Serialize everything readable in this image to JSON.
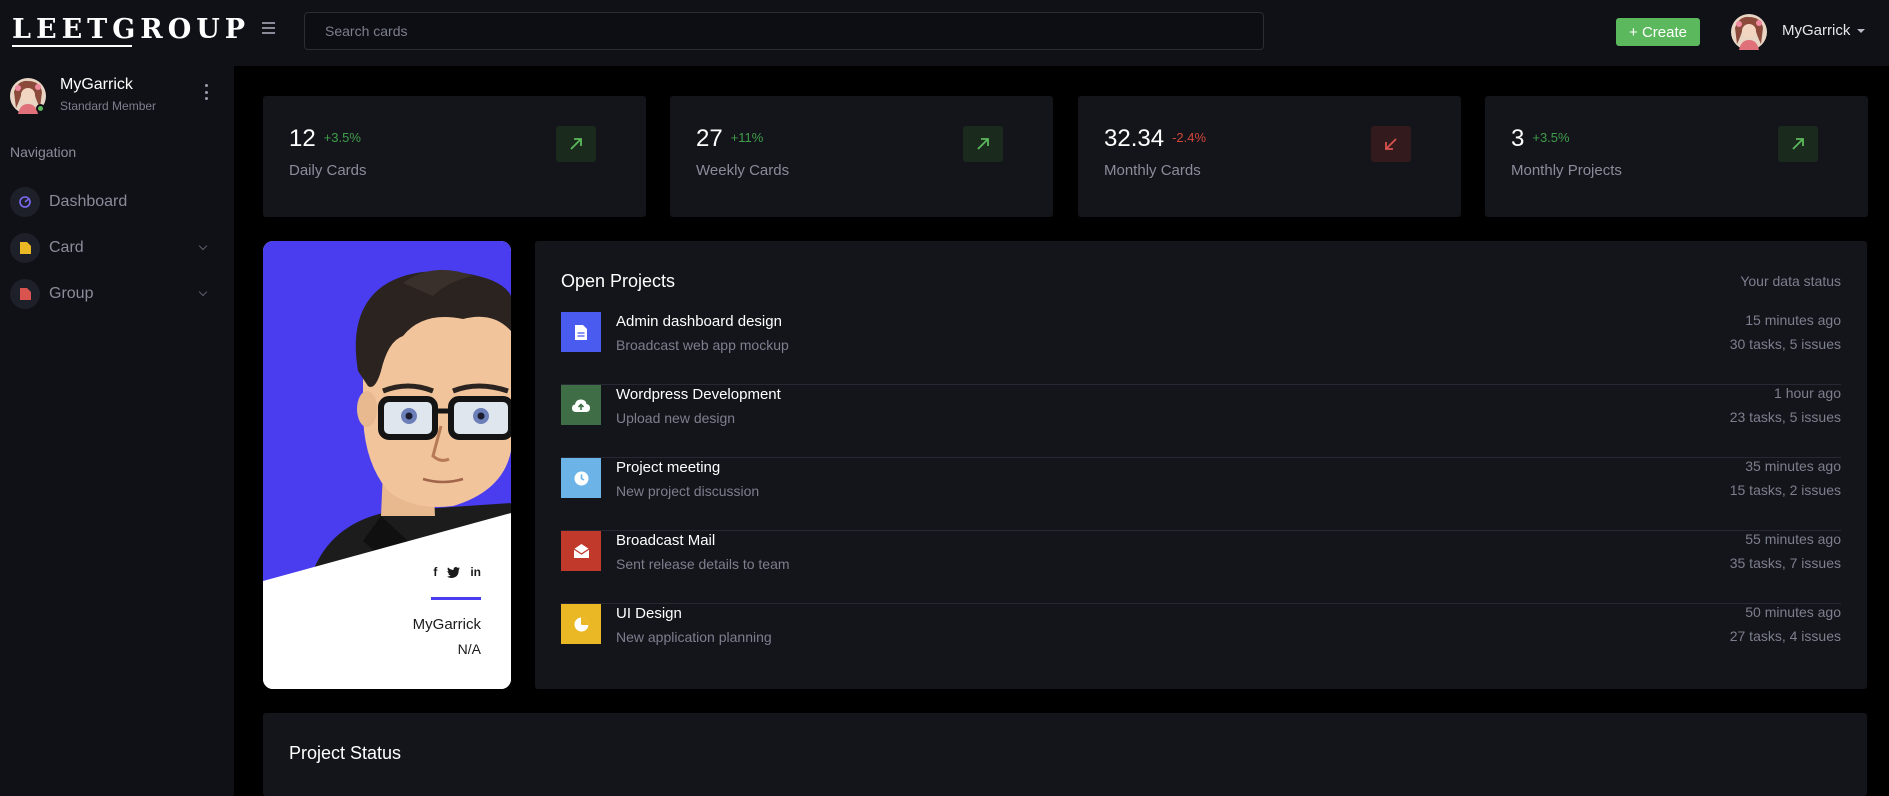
{
  "topbar": {
    "logo": "LEETGROUP",
    "search_placeholder": "Search cards",
    "create_label": "+ Create",
    "username": "MyGarrick"
  },
  "sidebar": {
    "user_name": "MyGarrick",
    "user_role": "Standard Member",
    "nav_title": "Navigation",
    "items": [
      {
        "label": "Dashboard",
        "icon": "dashboard-icon",
        "color": "#7b6cf6"
      },
      {
        "label": "Card",
        "icon": "card-icon",
        "color": "#e9b824"
      },
      {
        "label": "Group",
        "icon": "group-icon",
        "color": "#d9534f"
      }
    ]
  },
  "stats": [
    {
      "value": "12",
      "change": "+3.5%",
      "trend": "up",
      "label": "Daily Cards"
    },
    {
      "value": "27",
      "change": "+11%",
      "trend": "up",
      "label": "Weekly Cards"
    },
    {
      "value": "32.34",
      "change": "-2.4%",
      "trend": "down",
      "label": "Monthly Cards"
    },
    {
      "value": "3",
      "change": "+3.5%",
      "trend": "up",
      "label": "Monthly Projects"
    }
  ],
  "profile_card": {
    "name": "MyGarrick",
    "subtitle": "N/A",
    "socials": [
      "f",
      "t",
      "in"
    ]
  },
  "open_projects": {
    "title": "Open Projects",
    "status_label": "Your data status",
    "items": [
      {
        "name": "Admin dashboard design",
        "desc": "Broadcast web app mockup",
        "time": "15 minutes ago",
        "tasks": "30 tasks, 5 issues",
        "icon": "document-icon",
        "color": "#4a5cf0"
      },
      {
        "name": "Wordpress Development",
        "desc": "Upload new design",
        "time": "1 hour ago",
        "tasks": "23 tasks, 5 issues",
        "icon": "cloud-upload-icon",
        "color": "#3f6e46"
      },
      {
        "name": "Project meeting",
        "desc": "New project discussion",
        "time": "35 minutes ago",
        "tasks": "15 tasks, 2 issues",
        "icon": "clock-icon",
        "color": "#6cb4e8"
      },
      {
        "name": "Broadcast Mail",
        "desc": "Sent release details to team",
        "time": "55 minutes ago",
        "tasks": "35 tasks, 7 issues",
        "icon": "mail-icon",
        "color": "#c0392b"
      },
      {
        "name": "UI Design",
        "desc": "New application planning",
        "time": "50 minutes ago",
        "tasks": "27 tasks, 4 issues",
        "icon": "pie-chart-icon",
        "color": "#e9b824"
      }
    ]
  },
  "project_status": {
    "title": "Project Status"
  }
}
